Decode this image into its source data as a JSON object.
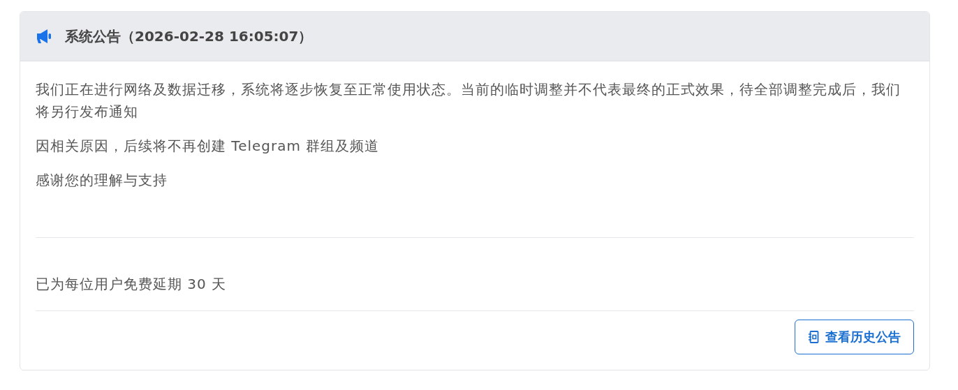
{
  "card": {
    "title": "系统公告（2026-02-28 16:05:07）",
    "paragraphs": [
      "我们正在进行网络及数据迁移，系统将逐步恢复至正常使用状态。当前的临时调整并不代表最终的正式效果，待全部调整完成后，我们将另行发布通知",
      "因相关原因，后续将不再创建 Telegram 群组及频道",
      "感谢您的理解与支持"
    ],
    "extension": "已为每位用户免费延期 30 天",
    "history_button": "查看历史公告"
  }
}
